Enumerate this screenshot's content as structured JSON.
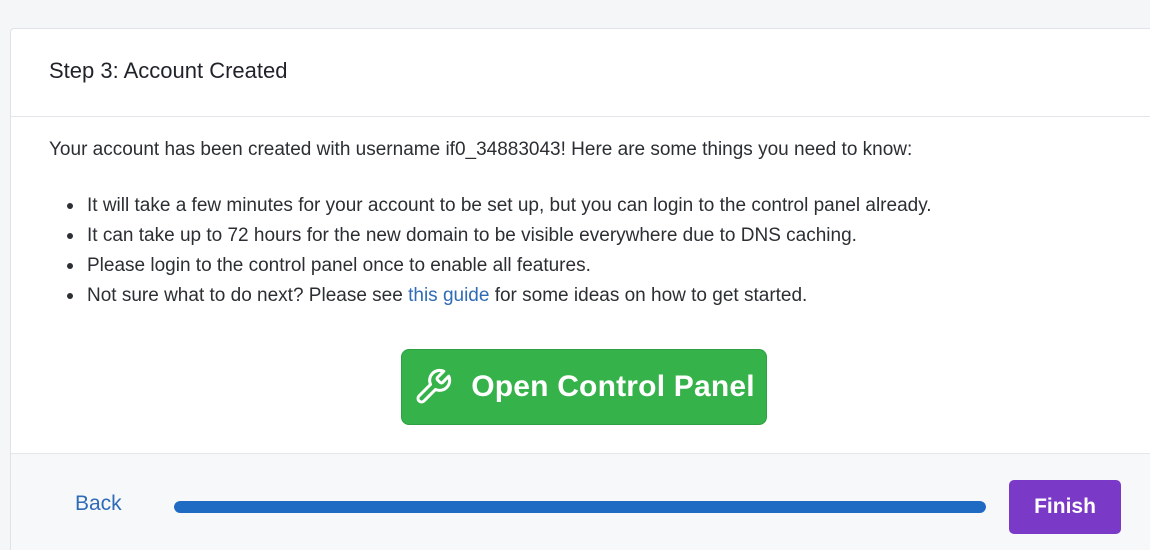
{
  "header": {
    "title": "Step 3: Account Created"
  },
  "body": {
    "intro": "Your account has been created with username if0_34883043! Here are some things you need to know:",
    "points": [
      "It will take a few minutes for your account to be set up, but you can login to the control panel already.",
      "It can take up to 72 hours for the new domain to be visible everywhere due to DNS caching.",
      "Please login to the control panel once to enable all features."
    ],
    "guide_point": {
      "before": "Not sure what to do next? Please see ",
      "link": "this guide",
      "after": " for some ideas on how to get started."
    },
    "control_panel_button": {
      "label": "Open Control Panel",
      "icon": "wrench-icon",
      "color": "#35b24a"
    }
  },
  "footer": {
    "back_label": "Back",
    "finish_label": "Finish",
    "progress_fraction": 1.0,
    "progress_color": "#1f6ac3",
    "finish_color": "#7b39c7"
  }
}
